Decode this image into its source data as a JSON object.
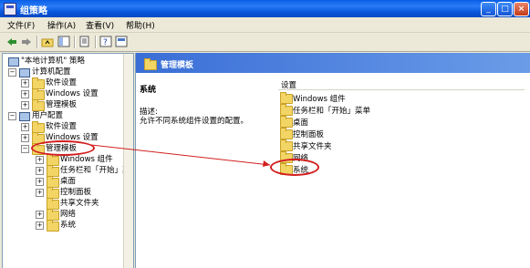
{
  "window": {
    "title": "组策略",
    "buttons": {
      "minimize": "_",
      "maximize": "□",
      "close": "×"
    }
  },
  "menubar": [
    "文件(F)",
    "操作(A)",
    "查看(V)",
    "帮助(H)"
  ],
  "toolbar": {
    "icons": [
      "back-icon",
      "forward-icon",
      "up-folder-icon",
      "show-tree-icon",
      "export-icon",
      "help-icon",
      "properties-icon"
    ]
  },
  "tree": {
    "root": "\"本地计算机\" 策略",
    "computer": {
      "label": "计算机配置",
      "children": [
        "软件设置",
        "Windows 设置",
        "管理模板"
      ]
    },
    "user": {
      "label": "用户配置",
      "children": [
        "软件设置",
        "Windows 设置",
        "管理模板"
      ],
      "admin_children": [
        "Windows 组件",
        "任务栏和「开始」菜",
        "桌面",
        "控制面板",
        "共享文件夹",
        "网络",
        "系统"
      ]
    }
  },
  "right_panel": {
    "header": "管理模板",
    "description": {
      "name": "系统",
      "label": "描述:",
      "text": "允许不同系统组件设置的配置。"
    },
    "list_header": "设置",
    "items": [
      "Windows 组件",
      "任务栏和「开始」菜单",
      "桌面",
      "控制面板",
      "共享文件夹",
      "网络",
      "系统"
    ]
  },
  "annotations": {
    "color": "#d21f1f"
  }
}
